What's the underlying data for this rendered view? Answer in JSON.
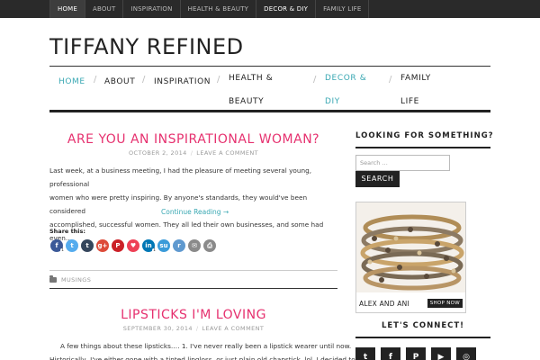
{
  "top_nav": {
    "items": [
      "HOME",
      "ABOUT",
      "INSPIRATION",
      "HEALTH & BEAUTY",
      "DECOR & DIY",
      "FAMILY LIFE"
    ]
  },
  "site": {
    "title": "TIFFANY REFINED"
  },
  "main_nav": {
    "items": [
      "HOME",
      "ABOUT",
      "INSPIRATION",
      "HEALTH &",
      "BEAUTY",
      "DECOR &",
      "DIY",
      "FAMILY",
      "LIFE"
    ],
    "separator": "/"
  },
  "posts": [
    {
      "title": "ARE YOU AN INSPIRATIONAL WOMAN?",
      "date": "OCTOBER 2, 2014",
      "comment_link": "LEAVE A COMMENT",
      "excerpt_lines": [
        "Last week, at a business meeting, I had the pleasure of meeting several young, professional",
        "women who were pretty inspiring. By anyone's standards, they would've been considered",
        "accomplished, successful women. They all led their own businesses, and some had even…"
      ],
      "more_link": "Continue Reading →",
      "share_label": "Share this:",
      "category": "MUSINGS"
    },
    {
      "title": "LIPSTICKS I'M LOVING",
      "date": "SEPTEMBER 30, 2014",
      "comment_link": "LEAVE A COMMENT",
      "excerpt_lines": [
        "A few things about these lipsticks….   1. I've never really been a lipstick wearer until now.",
        "Historically, I've either gone with a tinted lipgloss, or just plain old chapstick. lol. I decided to"
      ]
    }
  ],
  "share_buttons": [
    {
      "icon": "facebook-icon",
      "glyph": "f",
      "color": "#3b5998",
      "count": "1"
    },
    {
      "icon": "twitter-icon",
      "glyph": "t",
      "color": "#55acee",
      "count": ""
    },
    {
      "icon": "tumblr-icon",
      "glyph": "t",
      "color": "#35465c",
      "count": ""
    },
    {
      "icon": "google-plus-icon",
      "glyph": "g+",
      "color": "#dd4b39",
      "count": ""
    },
    {
      "icon": "pinterest-icon",
      "glyph": "P",
      "color": "#cb2027",
      "count": ""
    },
    {
      "icon": "pocket-icon",
      "glyph": "♥",
      "color": "#ee4056",
      "count": ""
    },
    {
      "icon": "linkedin-icon",
      "glyph": "in",
      "color": "#0077b5",
      "count": "1"
    },
    {
      "icon": "stumbleupon-icon",
      "glyph": "su",
      "color": "#3a9bd9",
      "count": ""
    },
    {
      "icon": "reddit-icon",
      "glyph": "r",
      "color": "#5f99cf",
      "count": ""
    },
    {
      "icon": "email-icon",
      "glyph": "✉",
      "color": "#8a8a8a",
      "count": ""
    },
    {
      "icon": "print-icon",
      "glyph": "⎙",
      "color": "#8a8a8a",
      "count": ""
    }
  ],
  "sidebar": {
    "search_title": "LOOKING FOR SOMETHING?",
    "search_placeholder": "Search …",
    "search_button": "SEARCH",
    "ad_brand": "ALEX AND ANI",
    "ad_cta": "SHOP NOW",
    "connect_title": "LET'S CONNECT!",
    "social": [
      {
        "icon": "twitter-icon",
        "glyph": "t"
      },
      {
        "icon": "facebook-icon",
        "glyph": "f"
      },
      {
        "icon": "pinterest-icon",
        "glyph": "P"
      },
      {
        "icon": "youtube-icon",
        "glyph": "▶"
      },
      {
        "icon": "instagram-icon",
        "glyph": "◎"
      }
    ]
  },
  "colors": {
    "accent_pink": "#e6316f",
    "accent_teal": "#3aa8b3",
    "dark": "#222222",
    "topbar": "#2a2a2a"
  }
}
